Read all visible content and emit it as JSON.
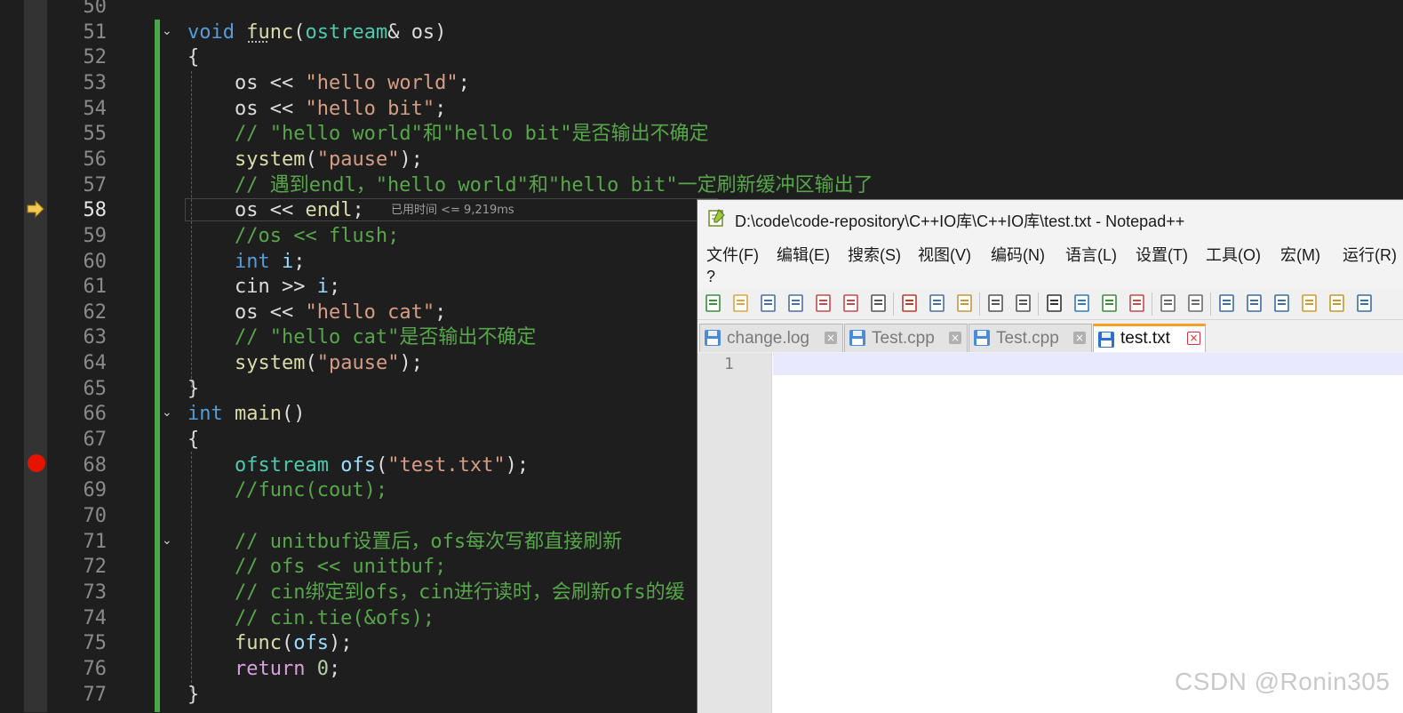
{
  "editor": {
    "lines": [
      {
        "n": "50",
        "tokens": []
      },
      {
        "n": "51",
        "tokens": [
          {
            "t": "void",
            "c": "kw"
          },
          {
            "t": " ",
            "c": "plain"
          },
          {
            "t": "func",
            "c": "fn"
          },
          {
            "t": "(",
            "c": "plain"
          },
          {
            "t": "ostream",
            "c": "ty"
          },
          {
            "t": "& ",
            "c": "plain"
          },
          {
            "t": "os",
            "c": "plain"
          },
          {
            "t": ")",
            "c": "plain"
          }
        ]
      },
      {
        "n": "52",
        "tokens": [
          {
            "t": "{",
            "c": "plain"
          }
        ]
      },
      {
        "n": "53",
        "tokens": [
          {
            "t": "    os << ",
            "c": "plain"
          },
          {
            "t": "\"hello world\"",
            "c": "str"
          },
          {
            "t": ";",
            "c": "plain"
          }
        ]
      },
      {
        "n": "54",
        "tokens": [
          {
            "t": "    os << ",
            "c": "plain"
          },
          {
            "t": "\"hello bit\"",
            "c": "str"
          },
          {
            "t": ";",
            "c": "plain"
          }
        ]
      },
      {
        "n": "55",
        "tokens": [
          {
            "t": "    // \"hello world\"和\"hello bit\"是否输出不确定",
            "c": "cm"
          }
        ]
      },
      {
        "n": "56",
        "tokens": [
          {
            "t": "    ",
            "c": "plain"
          },
          {
            "t": "system",
            "c": "fn"
          },
          {
            "t": "(",
            "c": "plain"
          },
          {
            "t": "\"pause\"",
            "c": "str"
          },
          {
            "t": ");",
            "c": "plain"
          }
        ]
      },
      {
        "n": "57",
        "tokens": [
          {
            "t": "    // 遇到endl，\"hello world\"和\"hello bit\"一定刷新缓冲区输出了",
            "c": "cm"
          }
        ]
      },
      {
        "n": "58",
        "tokens": [
          {
            "t": "    os << ",
            "c": "plain"
          },
          {
            "t": "endl",
            "c": "fn"
          },
          {
            "t": ";",
            "c": "plain"
          }
        ]
      },
      {
        "n": "59",
        "tokens": [
          {
            "t": "    //os << flush;",
            "c": "cm"
          }
        ]
      },
      {
        "n": "60",
        "tokens": [
          {
            "t": "    ",
            "c": "plain"
          },
          {
            "t": "int",
            "c": "kw"
          },
          {
            "t": " ",
            "c": "plain"
          },
          {
            "t": "i",
            "c": "var"
          },
          {
            "t": ";",
            "c": "plain"
          }
        ]
      },
      {
        "n": "61",
        "tokens": [
          {
            "t": "    cin >> ",
            "c": "plain"
          },
          {
            "t": "i",
            "c": "var"
          },
          {
            "t": ";",
            "c": "plain"
          }
        ]
      },
      {
        "n": "62",
        "tokens": [
          {
            "t": "    os << ",
            "c": "plain"
          },
          {
            "t": "\"hello cat\"",
            "c": "str"
          },
          {
            "t": ";",
            "c": "plain"
          }
        ]
      },
      {
        "n": "63",
        "tokens": [
          {
            "t": "    // \"hello cat\"是否输出不确定",
            "c": "cm"
          }
        ]
      },
      {
        "n": "64",
        "tokens": [
          {
            "t": "    ",
            "c": "plain"
          },
          {
            "t": "system",
            "c": "fn"
          },
          {
            "t": "(",
            "c": "plain"
          },
          {
            "t": "\"pause\"",
            "c": "str"
          },
          {
            "t": ");",
            "c": "plain"
          }
        ]
      },
      {
        "n": "65",
        "tokens": [
          {
            "t": "}",
            "c": "plain"
          }
        ]
      },
      {
        "n": "66",
        "tokens": [
          {
            "t": "int",
            "c": "kw"
          },
          {
            "t": " ",
            "c": "plain"
          },
          {
            "t": "main",
            "c": "fn"
          },
          {
            "t": "()",
            "c": "plain"
          }
        ]
      },
      {
        "n": "67",
        "tokens": [
          {
            "t": "{",
            "c": "plain"
          }
        ]
      },
      {
        "n": "68",
        "tokens": [
          {
            "t": "    ",
            "c": "plain"
          },
          {
            "t": "ofstream",
            "c": "ty"
          },
          {
            "t": " ",
            "c": "plain"
          },
          {
            "t": "ofs",
            "c": "var"
          },
          {
            "t": "(",
            "c": "plain"
          },
          {
            "t": "\"test.txt\"",
            "c": "str"
          },
          {
            "t": ");",
            "c": "plain"
          }
        ]
      },
      {
        "n": "69",
        "tokens": [
          {
            "t": "    //func(cout);",
            "c": "cm"
          }
        ]
      },
      {
        "n": "70",
        "tokens": []
      },
      {
        "n": "71",
        "tokens": [
          {
            "t": "    // unitbuf设置后，ofs每次写都直接刷新",
            "c": "cm"
          }
        ]
      },
      {
        "n": "72",
        "tokens": [
          {
            "t": "    // ofs << unitbuf;",
            "c": "cm"
          }
        ]
      },
      {
        "n": "73",
        "tokens": [
          {
            "t": "    // cin绑定到ofs，cin进行读时，会刷新ofs的缓",
            "c": "cm"
          }
        ]
      },
      {
        "n": "74",
        "tokens": [
          {
            "t": "    // cin.tie(&ofs);",
            "c": "cm"
          }
        ]
      },
      {
        "n": "75",
        "tokens": [
          {
            "t": "    ",
            "c": "plain"
          },
          {
            "t": "func",
            "c": "fn"
          },
          {
            "t": "(",
            "c": "plain"
          },
          {
            "t": "ofs",
            "c": "var"
          },
          {
            "t": ");",
            "c": "plain"
          }
        ]
      },
      {
        "n": "76",
        "tokens": [
          {
            "t": "    ",
            "c": "plain"
          },
          {
            "t": "return",
            "c": "ctl"
          },
          {
            "t": " ",
            "c": "plain"
          },
          {
            "t": "0",
            "c": "num"
          },
          {
            "t": ";",
            "c": "plain"
          }
        ]
      },
      {
        "n": "77",
        "tokens": [
          {
            "t": "}",
            "c": "plain"
          }
        ]
      }
    ],
    "fold_lines": [
      "51",
      "66",
      "71"
    ],
    "current_line": "58",
    "breakpoint_line": "68",
    "elapsed_hint": "已用时间 <= 9,219ms"
  },
  "notepad": {
    "title": "D:\\code\\code-repository\\C++IO库\\C++IO库\\test.txt - Notepad++",
    "menu": [
      "文件(F)",
      "编辑(E)",
      "搜索(S)",
      "视图(V)",
      "编码(N)",
      "语言(L)",
      "设置(T)",
      "工具(O)",
      "宏(M)",
      "运行(R)"
    ],
    "help_menu": "?",
    "toolbar_icons": [
      "new-file-icon",
      "open-file-icon",
      "save-icon",
      "save-all-icon",
      "close-icon",
      "close-all-icon",
      "print-icon",
      "cut-icon",
      "copy-icon",
      "paste-icon",
      "undo-icon",
      "redo-icon",
      "find-icon",
      "replace-icon",
      "zoom-in-icon",
      "zoom-out-icon",
      "sync-v-icon",
      "sync-h-icon",
      "word-wrap-icon",
      "show-all-chars-icon",
      "indent-guide-icon",
      "doc-map-icon",
      "function-list-icon",
      "folder-workspace-icon"
    ],
    "tabs": [
      {
        "label": "change.log",
        "active": false
      },
      {
        "label": "Test.cpp",
        "active": false
      },
      {
        "label": "Test.cpp",
        "active": false
      },
      {
        "label": "test.txt",
        "active": true
      }
    ],
    "line_number": "1",
    "colors": {
      "active_tab_accent": "#f6a028",
      "close_active": "#e0303b",
      "current_line": "#e8e8ff"
    }
  },
  "watermark": "CSDN @Ronin305"
}
